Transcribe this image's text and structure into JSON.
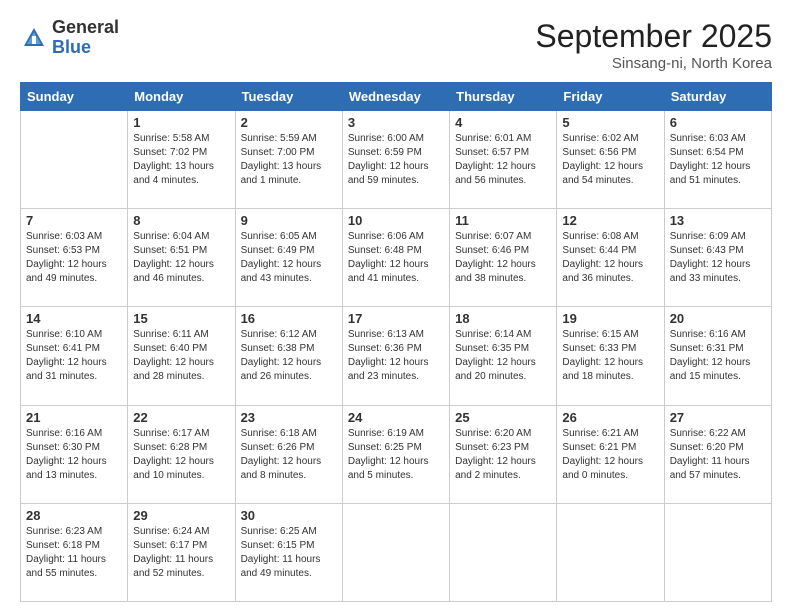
{
  "header": {
    "logo_general": "General",
    "logo_blue": "Blue",
    "month_title": "September 2025",
    "location": "Sinsang-ni, North Korea"
  },
  "days_of_week": [
    "Sunday",
    "Monday",
    "Tuesday",
    "Wednesday",
    "Thursday",
    "Friday",
    "Saturday"
  ],
  "weeks": [
    [
      {
        "day": "",
        "info": ""
      },
      {
        "day": "1",
        "info": "Sunrise: 5:58 AM\nSunset: 7:02 PM\nDaylight: 13 hours\nand 4 minutes."
      },
      {
        "day": "2",
        "info": "Sunrise: 5:59 AM\nSunset: 7:00 PM\nDaylight: 13 hours\nand 1 minute."
      },
      {
        "day": "3",
        "info": "Sunrise: 6:00 AM\nSunset: 6:59 PM\nDaylight: 12 hours\nand 59 minutes."
      },
      {
        "day": "4",
        "info": "Sunrise: 6:01 AM\nSunset: 6:57 PM\nDaylight: 12 hours\nand 56 minutes."
      },
      {
        "day": "5",
        "info": "Sunrise: 6:02 AM\nSunset: 6:56 PM\nDaylight: 12 hours\nand 54 minutes."
      },
      {
        "day": "6",
        "info": "Sunrise: 6:03 AM\nSunset: 6:54 PM\nDaylight: 12 hours\nand 51 minutes."
      }
    ],
    [
      {
        "day": "7",
        "info": "Sunrise: 6:03 AM\nSunset: 6:53 PM\nDaylight: 12 hours\nand 49 minutes."
      },
      {
        "day": "8",
        "info": "Sunrise: 6:04 AM\nSunset: 6:51 PM\nDaylight: 12 hours\nand 46 minutes."
      },
      {
        "day": "9",
        "info": "Sunrise: 6:05 AM\nSunset: 6:49 PM\nDaylight: 12 hours\nand 43 minutes."
      },
      {
        "day": "10",
        "info": "Sunrise: 6:06 AM\nSunset: 6:48 PM\nDaylight: 12 hours\nand 41 minutes."
      },
      {
        "day": "11",
        "info": "Sunrise: 6:07 AM\nSunset: 6:46 PM\nDaylight: 12 hours\nand 38 minutes."
      },
      {
        "day": "12",
        "info": "Sunrise: 6:08 AM\nSunset: 6:44 PM\nDaylight: 12 hours\nand 36 minutes."
      },
      {
        "day": "13",
        "info": "Sunrise: 6:09 AM\nSunset: 6:43 PM\nDaylight: 12 hours\nand 33 minutes."
      }
    ],
    [
      {
        "day": "14",
        "info": "Sunrise: 6:10 AM\nSunset: 6:41 PM\nDaylight: 12 hours\nand 31 minutes."
      },
      {
        "day": "15",
        "info": "Sunrise: 6:11 AM\nSunset: 6:40 PM\nDaylight: 12 hours\nand 28 minutes."
      },
      {
        "day": "16",
        "info": "Sunrise: 6:12 AM\nSunset: 6:38 PM\nDaylight: 12 hours\nand 26 minutes."
      },
      {
        "day": "17",
        "info": "Sunrise: 6:13 AM\nSunset: 6:36 PM\nDaylight: 12 hours\nand 23 minutes."
      },
      {
        "day": "18",
        "info": "Sunrise: 6:14 AM\nSunset: 6:35 PM\nDaylight: 12 hours\nand 20 minutes."
      },
      {
        "day": "19",
        "info": "Sunrise: 6:15 AM\nSunset: 6:33 PM\nDaylight: 12 hours\nand 18 minutes."
      },
      {
        "day": "20",
        "info": "Sunrise: 6:16 AM\nSunset: 6:31 PM\nDaylight: 12 hours\nand 15 minutes."
      }
    ],
    [
      {
        "day": "21",
        "info": "Sunrise: 6:16 AM\nSunset: 6:30 PM\nDaylight: 12 hours\nand 13 minutes."
      },
      {
        "day": "22",
        "info": "Sunrise: 6:17 AM\nSunset: 6:28 PM\nDaylight: 12 hours\nand 10 minutes."
      },
      {
        "day": "23",
        "info": "Sunrise: 6:18 AM\nSunset: 6:26 PM\nDaylight: 12 hours\nand 8 minutes."
      },
      {
        "day": "24",
        "info": "Sunrise: 6:19 AM\nSunset: 6:25 PM\nDaylight: 12 hours\nand 5 minutes."
      },
      {
        "day": "25",
        "info": "Sunrise: 6:20 AM\nSunset: 6:23 PM\nDaylight: 12 hours\nand 2 minutes."
      },
      {
        "day": "26",
        "info": "Sunrise: 6:21 AM\nSunset: 6:21 PM\nDaylight: 12 hours\nand 0 minutes."
      },
      {
        "day": "27",
        "info": "Sunrise: 6:22 AM\nSunset: 6:20 PM\nDaylight: 11 hours\nand 57 minutes."
      }
    ],
    [
      {
        "day": "28",
        "info": "Sunrise: 6:23 AM\nSunset: 6:18 PM\nDaylight: 11 hours\nand 55 minutes."
      },
      {
        "day": "29",
        "info": "Sunrise: 6:24 AM\nSunset: 6:17 PM\nDaylight: 11 hours\nand 52 minutes."
      },
      {
        "day": "30",
        "info": "Sunrise: 6:25 AM\nSunset: 6:15 PM\nDaylight: 11 hours\nand 49 minutes."
      },
      {
        "day": "",
        "info": ""
      },
      {
        "day": "",
        "info": ""
      },
      {
        "day": "",
        "info": ""
      },
      {
        "day": "",
        "info": ""
      }
    ]
  ]
}
